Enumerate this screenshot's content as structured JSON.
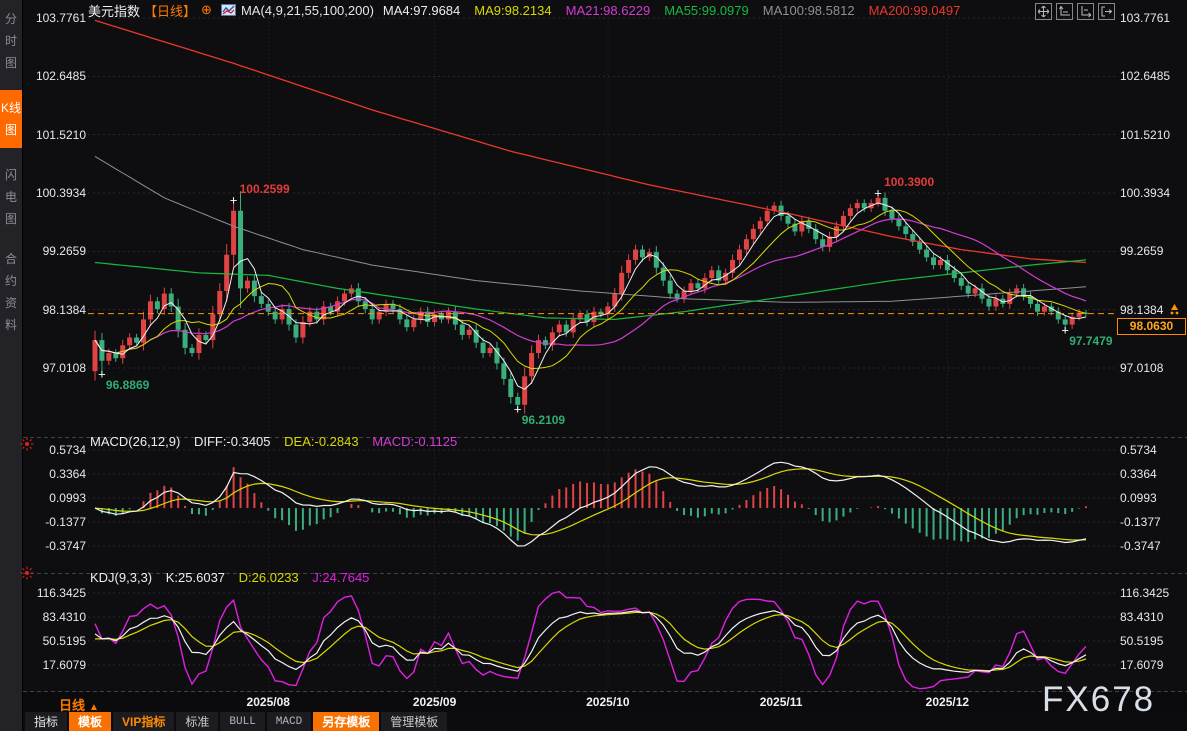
{
  "window": {
    "watermark": "FX678"
  },
  "sidebar": {
    "tabs": [
      {
        "label": "分时图",
        "active": false
      },
      {
        "label": "K线图",
        "active": true
      },
      {
        "label": "闪电图",
        "active": false
      },
      {
        "label": "合约资料",
        "active": false
      }
    ]
  },
  "header": {
    "symbol": "美元指数",
    "period_tag": "【日线】",
    "add_icon": "⊕",
    "ma_group": "MA(4,9,21,55,100,200)",
    "ma_values": [
      {
        "label": "MA4:97.9684",
        "color": "#ededf0"
      },
      {
        "label": "MA9:98.2134",
        "color": "#d9d900"
      },
      {
        "label": "MA21:98.6229",
        "color": "#d23cd2"
      },
      {
        "label": "MA55:99.0979",
        "color": "#18b93e"
      },
      {
        "label": "MA100:98.5812",
        "color": "#8f8f96"
      },
      {
        "label": "MA200:99.0497",
        "color": "#e8392a"
      }
    ]
  },
  "macd_header": {
    "title": "MACD(26,12,9)",
    "diff": "DIFF:-0.3405",
    "dea": "DEA:-0.2843",
    "macd": "MACD:-0.1125"
  },
  "kdj_header": {
    "title": "KDJ(9,3,3)",
    "k": "K:25.6037",
    "d": "D:26.0233",
    "j": "J:24.7645"
  },
  "last_price": {
    "label": "98.0630",
    "value": 98.063
  },
  "footer": {
    "period_label": "日线",
    "period_arrow": "▲",
    "tabs": [
      {
        "label": "指标",
        "style": "plain"
      },
      {
        "label": "模板",
        "style": "orange-bg"
      },
      {
        "label": "VIP指标",
        "style": "orange-text"
      },
      {
        "label": "标准",
        "style": "light"
      },
      {
        "label": "BULL",
        "style": "mono"
      },
      {
        "label": "MACD",
        "style": "mono"
      },
      {
        "label": "另存模板",
        "style": "orange-bg"
      },
      {
        "label": "管理模板",
        "style": "light"
      }
    ]
  },
  "colors": {
    "up": "#e04343",
    "down": "#3bae7e",
    "ma4": "#f2f2f2",
    "ma9": "#d9d900",
    "ma21": "#d23cd2",
    "ma55": "#18b93e",
    "ma100": "#8f8f96",
    "ma200": "#e8392a",
    "diff": "#f2f2f2",
    "dea": "#d9d900",
    "k": "#f2f2f2",
    "d": "#d9d900",
    "j": "#e020e0",
    "accent_orange": "#ff7a00",
    "annotation_high": "#e23b3b",
    "annotation_low": "#2fae74",
    "last_price_line": "#ff9500",
    "last_price_text": "#ffa61a"
  },
  "chart_data": {
    "type": "candlestick",
    "symbol": "美元指数",
    "period": "日线",
    "y_ticks_main": [
      "103.7761",
      "102.6485",
      "101.5210",
      "100.3934",
      "99.2659",
      "98.1384",
      "97.0108"
    ],
    "y_ticks_macd": [
      "0.5734",
      "0.3364",
      "0.0993",
      "-0.1377",
      "-0.3747"
    ],
    "y_ticks_kdj": [
      "116.3425",
      "83.4310",
      "50.5195",
      "17.6079"
    ],
    "x_ticks": [
      {
        "label": "2025/08",
        "index": 25
      },
      {
        "label": "2025/09",
        "index": 49
      },
      {
        "label": "2025/10",
        "index": 74
      },
      {
        "label": "2025/11",
        "index": 99
      },
      {
        "label": "2025/12",
        "index": 123
      }
    ],
    "first_open": 96.95,
    "closes": [
      97.55,
      97.15,
      97.3,
      97.2,
      97.45,
      97.6,
      97.5,
      97.95,
      98.3,
      98.15,
      98.45,
      98.2,
      97.75,
      97.4,
      97.3,
      97.65,
      97.55,
      98.05,
      98.5,
      99.2,
      100.05,
      98.55,
      98.7,
      98.4,
      98.25,
      98.1,
      97.95,
      98.15,
      97.85,
      97.6,
      97.9,
      98.1,
      97.95,
      98.2,
      98.1,
      98.3,
      98.45,
      98.55,
      98.3,
      98.15,
      97.95,
      98.1,
      98.25,
      98.15,
      97.95,
      97.8,
      97.95,
      98.1,
      97.9,
      98.05,
      97.95,
      98.1,
      97.85,
      97.65,
      97.75,
      97.5,
      97.3,
      97.4,
      97.1,
      96.8,
      96.45,
      96.3,
      96.85,
      97.3,
      97.55,
      97.45,
      97.7,
      97.85,
      97.7,
      97.95,
      98.05,
      97.9,
      98.1,
      98.05,
      98.2,
      98.45,
      98.85,
      99.1,
      99.3,
      99.15,
      99.25,
      98.95,
      98.7,
      98.45,
      98.35,
      98.5,
      98.65,
      98.55,
      98.75,
      98.9,
      98.7,
      98.85,
      99.1,
      99.3,
      99.5,
      99.7,
      99.85,
      100.05,
      100.15,
      99.95,
      99.8,
      99.65,
      99.85,
      99.7,
      99.5,
      99.35,
      99.55,
      99.75,
      99.95,
      100.1,
      100.2,
      100.1,
      100.2,
      100.3,
      100.05,
      99.9,
      99.75,
      99.6,
      99.45,
      99.3,
      99.15,
      99.0,
      99.1,
      98.9,
      98.75,
      98.6,
      98.45,
      98.55,
      98.35,
      98.2,
      98.35,
      98.25,
      98.45,
      98.55,
      98.4,
      98.25,
      98.1,
      98.2,
      98.1,
      97.95,
      97.85,
      98.0,
      98.08,
      98.06
    ],
    "wick_overrides": [
      {
        "i": 1,
        "low": 96.8869
      },
      {
        "i": 20,
        "high": 100.2599
      },
      {
        "i": 61,
        "low": 96.2109
      },
      {
        "i": 113,
        "high": 100.39
      },
      {
        "i": 140,
        "low": 97.7479
      }
    ],
    "annotations": [
      {
        "label": "100.2599",
        "value": 100.2599,
        "index": 20,
        "kind": "high"
      },
      {
        "label": "96.8869",
        "value": 96.8869,
        "index": 1,
        "kind": "low"
      },
      {
        "label": "96.2109",
        "value": 96.2109,
        "index": 61,
        "kind": "low"
      },
      {
        "label": "100.3900",
        "value": 100.39,
        "index": 113,
        "kind": "high"
      },
      {
        "label": "97.7479",
        "value": 97.7479,
        "index": 140,
        "kind": "low"
      }
    ],
    "ma_overlays": {
      "ma55": {
        "anchors": [
          [
            0,
            99.05
          ],
          [
            15,
            98.85
          ],
          [
            25,
            98.8
          ],
          [
            35,
            98.55
          ],
          [
            45,
            98.35
          ],
          [
            55,
            98.15
          ],
          [
            65,
            97.98
          ],
          [
            75,
            97.95
          ],
          [
            85,
            98.1
          ],
          [
            95,
            98.3
          ],
          [
            105,
            98.5
          ],
          [
            115,
            98.7
          ],
          [
            125,
            98.85
          ],
          [
            135,
            99.0
          ],
          [
            143,
            99.1
          ]
        ]
      },
      "ma100": {
        "anchors": [
          [
            0,
            101.1
          ],
          [
            10,
            100.3
          ],
          [
            20,
            99.75
          ],
          [
            30,
            99.3
          ],
          [
            40,
            99.0
          ],
          [
            55,
            98.7
          ],
          [
            70,
            98.5
          ],
          [
            85,
            98.35
          ],
          [
            100,
            98.28
          ],
          [
            115,
            98.3
          ],
          [
            130,
            98.45
          ],
          [
            143,
            98.58
          ]
        ]
      },
      "ma200": {
        "anchors": [
          [
            0,
            103.73
          ],
          [
            20,
            102.9
          ],
          [
            40,
            102.0
          ],
          [
            60,
            101.2
          ],
          [
            80,
            100.55
          ],
          [
            100,
            100.0
          ],
          [
            115,
            99.55
          ],
          [
            125,
            99.3
          ],
          [
            135,
            99.12
          ],
          [
            143,
            99.05
          ]
        ]
      }
    }
  }
}
